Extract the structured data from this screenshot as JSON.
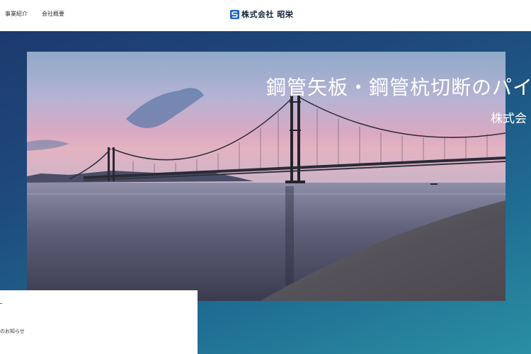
{
  "header": {
    "nav": [
      {
        "label": "事業紹介"
      },
      {
        "label": "会社概要"
      }
    ],
    "brand": {
      "name": "株式会社 昭栄",
      "mark": "s-logo-icon"
    }
  },
  "hero": {
    "title": "鋼管矢板・鋼管杭切断のパイオ",
    "subtitle": "株式会",
    "photo": "suspension-bridge-at-dusk",
    "colors": {
      "gradient_start": "#1d3a6e",
      "gradient_end": "#2a8fa3"
    }
  },
  "news": {
    "label": "のお知らせ"
  }
}
